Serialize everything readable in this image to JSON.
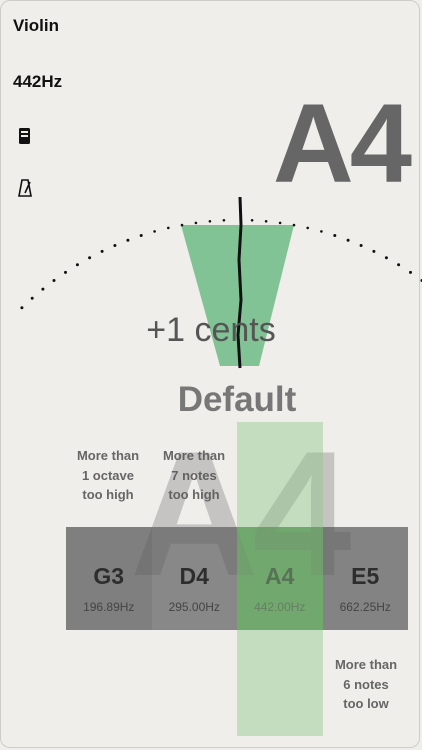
{
  "sidebar": {
    "instrument": "Violin",
    "reference_freq": "442Hz",
    "tuner_icon": "tuner-icon",
    "metronome_icon": "metronome-icon"
  },
  "tuner": {
    "detected_note": "A4",
    "cents_text": "+1 cents",
    "cents_value": 1,
    "temperament": "Default",
    "accent_color": "#6dbb86",
    "active_color": "#5a8f58"
  },
  "strings": [
    {
      "note": "G3",
      "freq": "196.89Hz",
      "hint": [
        "More than",
        "1 octave",
        "too high"
      ],
      "active": false
    },
    {
      "note": "D4",
      "freq": "295.00Hz",
      "hint": [
        "More than",
        "7 notes",
        "too high"
      ],
      "active": false
    },
    {
      "note": "A4",
      "freq": "442.00Hz",
      "hint": [],
      "active": true
    },
    {
      "note": "E5",
      "freq": "662.25Hz",
      "hint": [
        "More than",
        "6 notes",
        "too low"
      ],
      "active": false
    }
  ]
}
